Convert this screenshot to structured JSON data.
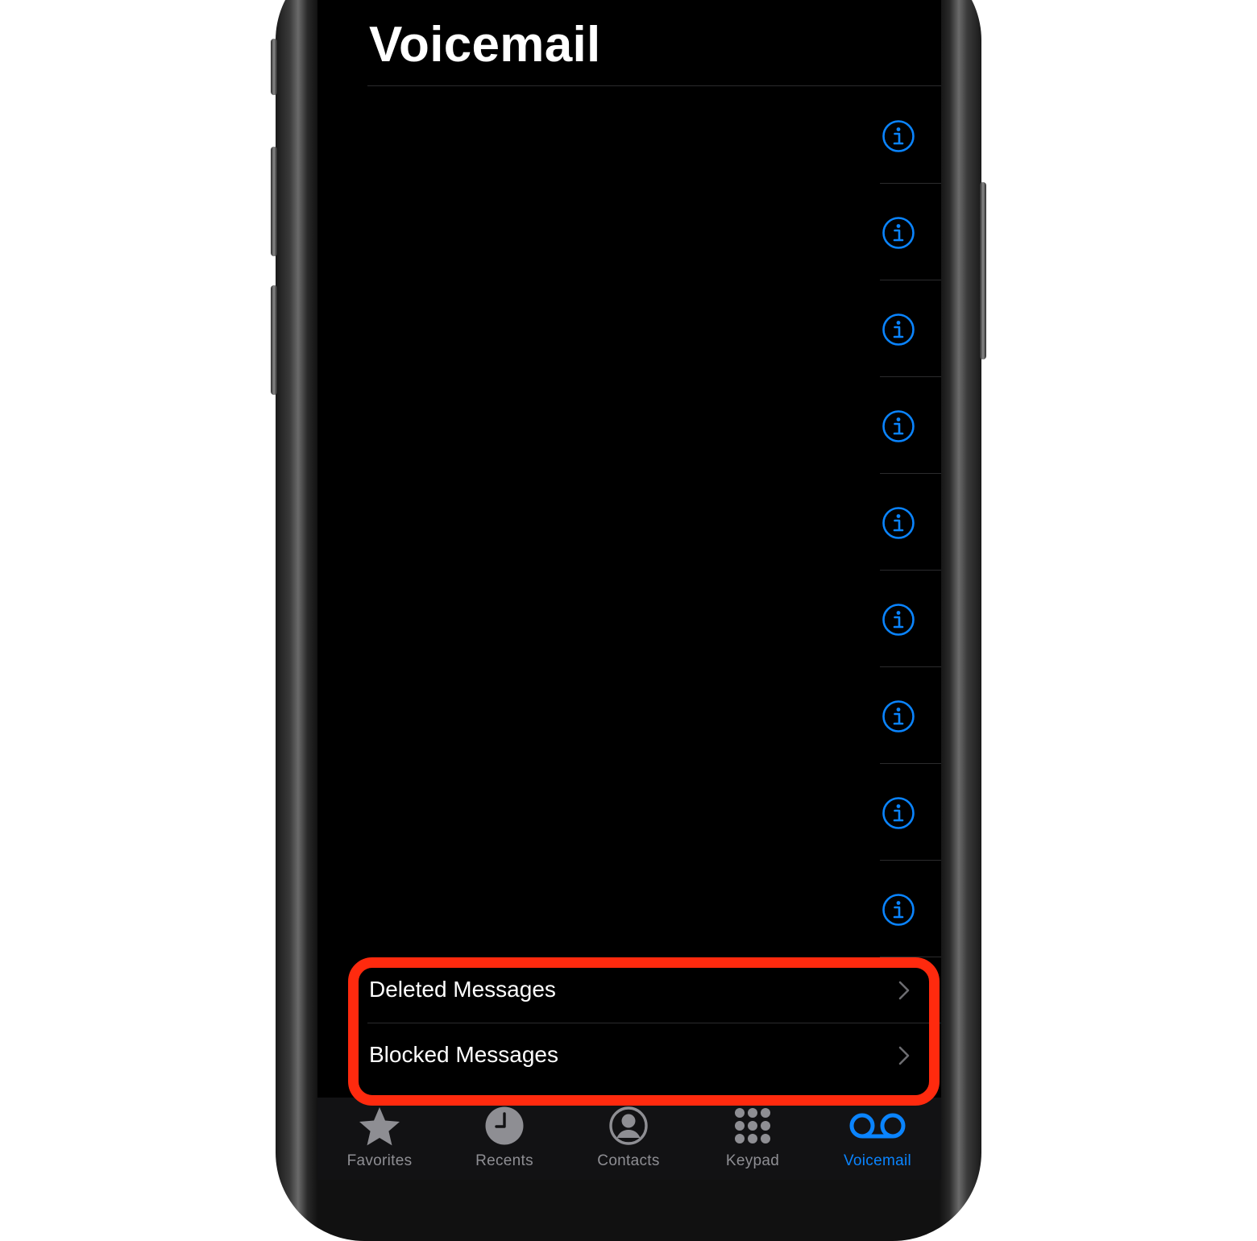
{
  "header": {
    "title": "Voicemail"
  },
  "voicemail_list": {
    "row_count": 9,
    "info_icon": "info-circle-icon"
  },
  "folders": [
    {
      "label": "Deleted Messages",
      "icon": "chevron-right-icon"
    },
    {
      "label": "Blocked Messages",
      "icon": "chevron-right-icon"
    }
  ],
  "tabbar": {
    "tabs": [
      {
        "label": "Favorites",
        "icon": "star-icon",
        "active": false
      },
      {
        "label": "Recents",
        "icon": "clock-icon",
        "active": false
      },
      {
        "label": "Contacts",
        "icon": "person-circle-icon",
        "active": false
      },
      {
        "label": "Keypad",
        "icon": "keypad-icon",
        "active": false
      },
      {
        "label": "Voicemail",
        "icon": "voicemail-icon",
        "active": true
      }
    ]
  },
  "colors": {
    "accent": "#0a84ff",
    "highlight": "#ff2a0e",
    "background": "#000000",
    "inactive_tab": "#8e8e93"
  }
}
